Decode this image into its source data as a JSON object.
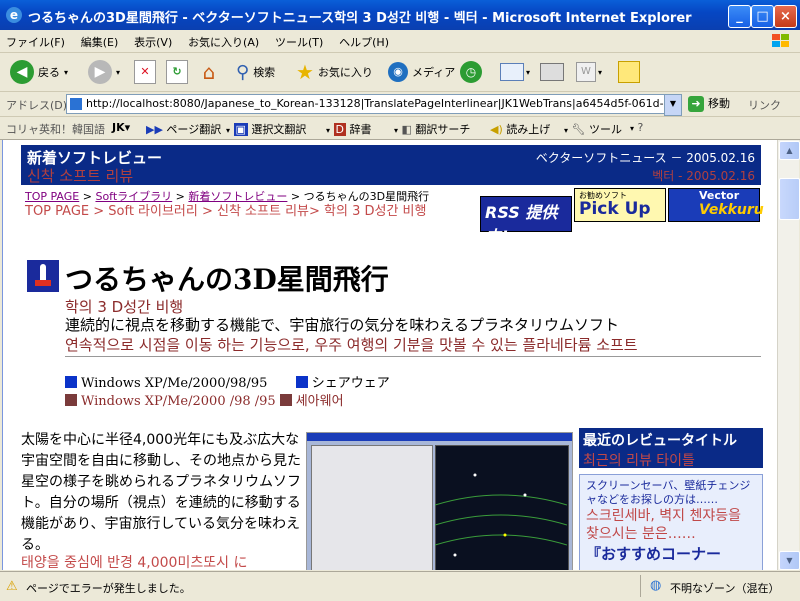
{
  "window": {
    "title": "つるちゃんの3D星間飛行 - ベクターソフトニュース학의 3 D성간 비행 - 벡터 - Microsoft Internet Explorer",
    "controls": {
      "minimize": "_",
      "maximize": "□",
      "close": "×"
    }
  },
  "menu": [
    "ファイル(F)",
    "編集(E)",
    "表示(V)",
    "お気に入り(A)",
    "ツール(T)",
    "ヘルプ(H)"
  ],
  "toolbar": {
    "back": "戻る",
    "search": "検索",
    "favorites": "お気に入り",
    "media": "メディア"
  },
  "address": {
    "label": "アドレス(D)",
    "url": "http://localhost:8080/Japanese_to_Korean-133128|TranslatePageInterlinear|JK1WebTrans|a6454d5f-061d-4feb-a",
    "go": "移動",
    "links": "リンク"
  },
  "koreanbar": {
    "label": "コリャ英和！韓国語",
    "jk": "JK▾",
    "page_translate": "ページ翻訳",
    "selection_translate": "選択文翻訳",
    "dictionary": "辞書",
    "translate_search": "翻訳サーチ",
    "read_aloud": "読み上げ",
    "tools": "ツール"
  },
  "page": {
    "header_left_jp": "新着ソフトレビュー",
    "header_left_kr": "신착 소프트 리뷰",
    "header_right_jp": "ベクターソフトニュース － 2005.02.16",
    "header_right_kr": "벡터 - 2005.02.16",
    "breadcrumb": {
      "top": "TOP PAGE",
      "sep1": " > ",
      "lib": "Softライブラリ",
      "sep2": " > ",
      "review": "新着ソフトレビュー",
      "current": " > つるちゃんの3D星間飛行"
    },
    "breadcrumb_kr": "TOP PAGE > Soft 라이브러리 > 신착 소프트 리뷰> 학의 3 D성간 비행",
    "banners": {
      "rss": "RSS 提供中!",
      "pickup_small": "お勧めソフト",
      "pickup": "Pick Up",
      "vector_top": "Vector",
      "vector_main": "Vekkuru"
    },
    "title_jp": "つるちゃんの3D星間飛行",
    "title_kr": "학의 3 D성간 비행",
    "subtitle_jp": "連続的に視点を移動する機能で、宇宙旅行の気分を味わえるプラネタリウムソフト",
    "subtitle_kr": "연속적으로 시점을 이동 하는 기능으로, 우주 여행의 기분을 맛볼 수 있는 플라네타륨 소프트",
    "os_jp": "Windows XP/Me/2000/98/95",
    "license_jp": "シェアウェア",
    "os_kr": "Windows XP/Me/2000 /98 /95",
    "license_kr": "셰아웨어",
    "body_jp": "太陽を中心に半径4,000光年にも及ぶ広大な宇宙空間を自由に移動し、その地点から見た星空の様子を眺められるプラネタリウムソフト。自分の場所（視点）を連続的に移動する機能があり、宇宙旅行している気分を味わえる。",
    "body_kr": "태양을 중심에 반경 4,000미츠또시 に",
    "recent_title_jp": "最近のレビュータイトル",
    "recent_title_kr": "최근의 리뷰 타이틀",
    "screensaver_jp": "スクリーンセーバ、壁紙チェンジャなどをお探しの方は……",
    "screensaver_kr": "스크린세바, 벽지 첸쟈등을 찾으시는 분은……",
    "more_jp": "『おすすめコーナー"
  },
  "status": {
    "text": "ページでエラーが発生しました。",
    "zone": "不明なゾーン（混在）"
  }
}
